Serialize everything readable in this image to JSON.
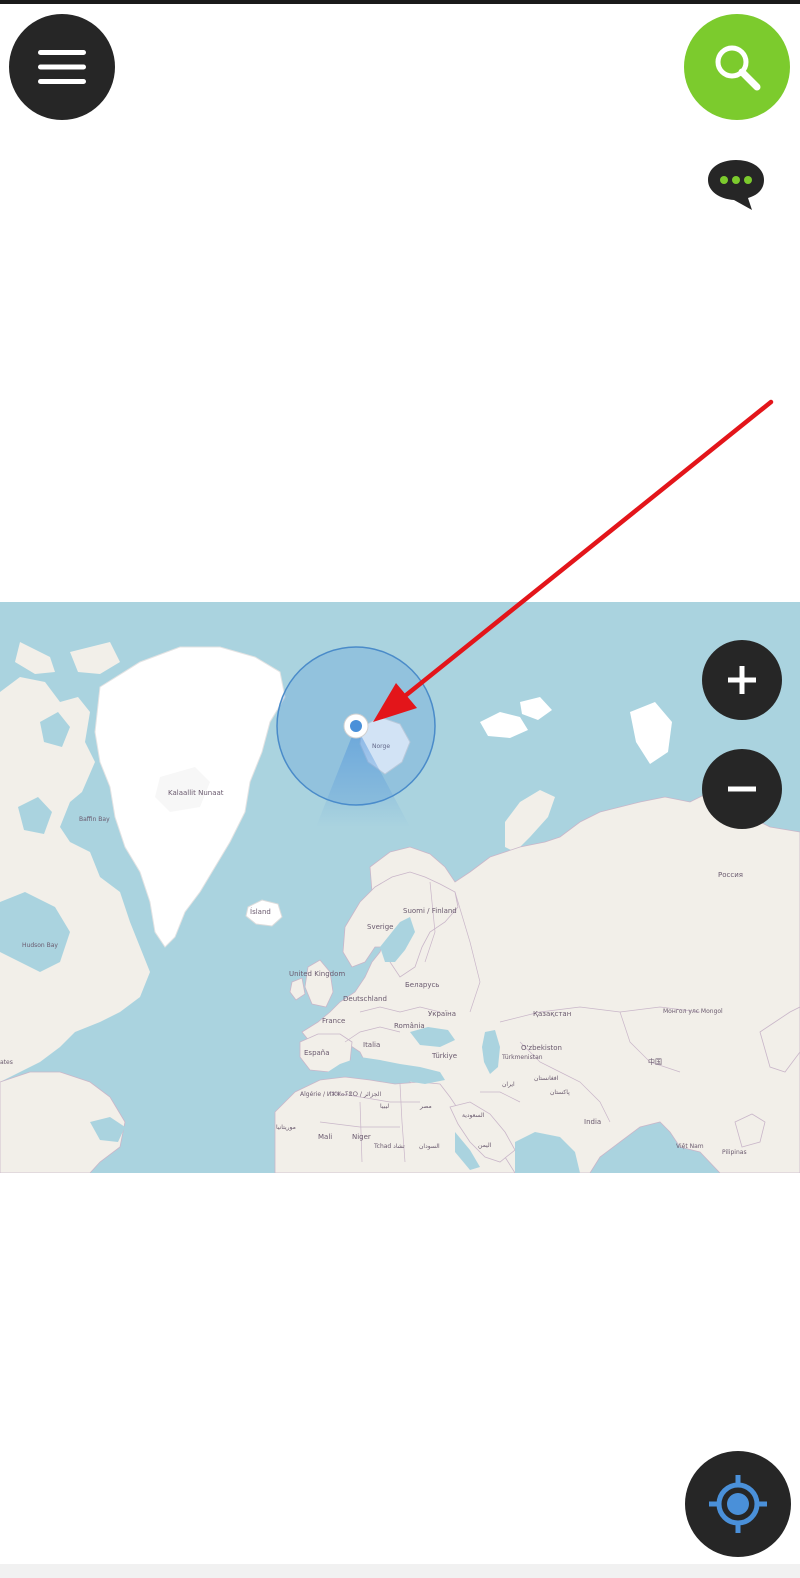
{
  "buttons": {
    "menu": "menu-icon",
    "search": "search-icon",
    "chat": "chat-bubble-icon",
    "zoom_in_label": "+",
    "zoom_out_label": "−",
    "locate": "locate-target-icon"
  },
  "colors": {
    "button_dark": "#262626",
    "search_green": "#7ccb2d",
    "ocean": "#aad3df",
    "land": "#f2efe9",
    "ice": "#ffffff",
    "location_blue": "#4a90d9",
    "annotation_red": "#e3151a"
  },
  "map": {
    "labels": {
      "greenland": "Kalaallit Nunaat",
      "iceland": "Ísland",
      "russia": "Россия",
      "sverige": "Sverige",
      "suomi": "Suomi / Finland",
      "norge": "Norge",
      "uk": "United Kingdom",
      "deutschland": "Deutschland",
      "belarus": "Беларусь",
      "ukraine": "Україна",
      "kazakhstan": "Қазақстан",
      "mongolia": "Монгол улс Mongol",
      "france": "France",
      "romania": "România",
      "espana": "España",
      "italia": "Italia",
      "turkiye": "Türkiye",
      "uzbekistan": "O'zbekiston",
      "turkmenistan": "Türkmenistan",
      "china": "中国",
      "algerie": "Algérie / ⵍⵣⵣⴰⵢⴻⵔ / الجزائر",
      "libya": "ليبيا",
      "egypt": "مصر",
      "iran": "ایران",
      "afghanistan": "افغانستان",
      "pakistan": "پاکستان",
      "saudi": "السعودية",
      "india": "India",
      "mauritania": "موريتانيا",
      "mali": "Mali",
      "niger": "Niger",
      "tchad": "Tchad تشاد",
      "sudan": "السودان",
      "yemen": "اليمن",
      "vietnam": "Việt Nam",
      "philippines": "Pilipinas",
      "states": "ates",
      "baffin_bay": "Baffin Bay",
      "hudson_bay": "Hudson Bay"
    }
  }
}
